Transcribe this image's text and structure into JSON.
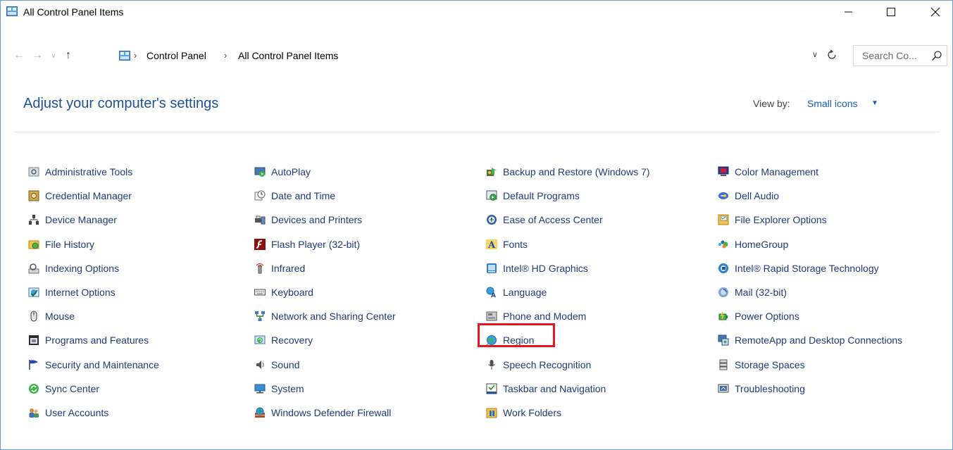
{
  "window": {
    "title": "All Control Panel Items",
    "minimize_glyph": "—",
    "maximize_glyph": "☐",
    "close_glyph": "✕"
  },
  "nav": {
    "back_glyph": "←",
    "forward_glyph": "→",
    "recent_glyph": "∨",
    "up_glyph": "↑"
  },
  "address": {
    "separator": "›",
    "crumbs": [
      "Control Panel",
      "All Control Panel Items"
    ],
    "dropdown_glyph": "∨"
  },
  "search": {
    "placeholder": "Search Co..."
  },
  "header": {
    "title": "Adjust your computer's settings",
    "view_by_label": "View by:",
    "view_by_value": "Small icons",
    "view_by_caret": "▼"
  },
  "columns": [
    {
      "items": [
        {
          "label": "Administrative Tools",
          "icon": "admin-tools-icon"
        },
        {
          "label": "Credential Manager",
          "icon": "credential-icon"
        },
        {
          "label": "Device Manager",
          "icon": "device-manager-icon"
        },
        {
          "label": "File History",
          "icon": "file-history-icon"
        },
        {
          "label": "Indexing Options",
          "icon": "indexing-icon"
        },
        {
          "label": "Internet Options",
          "icon": "internet-options-icon"
        },
        {
          "label": "Mouse",
          "icon": "mouse-icon"
        },
        {
          "label": "Programs and Features",
          "icon": "programs-icon"
        },
        {
          "label": "Security and Maintenance",
          "icon": "flag-icon"
        },
        {
          "label": "Sync Center",
          "icon": "sync-icon"
        },
        {
          "label": "User Accounts",
          "icon": "users-icon"
        }
      ]
    },
    {
      "items": [
        {
          "label": "AutoPlay",
          "icon": "autoplay-icon"
        },
        {
          "label": "Date and Time",
          "icon": "clock-icon"
        },
        {
          "label": "Devices and Printers",
          "icon": "printer-icon"
        },
        {
          "label": "Flash Player (32-bit)",
          "icon": "flash-icon"
        },
        {
          "label": "Infrared",
          "icon": "infrared-icon"
        },
        {
          "label": "Keyboard",
          "icon": "keyboard-icon"
        },
        {
          "label": "Network and Sharing Center",
          "icon": "network-icon"
        },
        {
          "label": "Recovery",
          "icon": "recovery-icon"
        },
        {
          "label": "Sound",
          "icon": "speaker-icon"
        },
        {
          "label": "System",
          "icon": "monitor-icon"
        },
        {
          "label": "Windows Defender Firewall",
          "icon": "firewall-icon"
        }
      ]
    },
    {
      "items": [
        {
          "label": "Backup and Restore (Windows 7)",
          "icon": "backup-icon"
        },
        {
          "label": "Default Programs",
          "icon": "default-programs-icon"
        },
        {
          "label": "Ease of Access Center",
          "icon": "ease-access-icon"
        },
        {
          "label": "Fonts",
          "icon": "fonts-icon"
        },
        {
          "label": "Intel® HD Graphics",
          "icon": "intel-graphics-icon"
        },
        {
          "label": "Language",
          "icon": "language-icon"
        },
        {
          "label": "Phone and Modem",
          "icon": "phone-icon"
        },
        {
          "label": "Region",
          "icon": "globe-icon"
        },
        {
          "label": "Speech Recognition",
          "icon": "microphone-icon"
        },
        {
          "label": "Taskbar and Navigation",
          "icon": "taskbar-icon"
        },
        {
          "label": "Work Folders",
          "icon": "work-folders-icon"
        }
      ]
    },
    {
      "items": [
        {
          "label": "Color Management",
          "icon": "color-monitor-icon"
        },
        {
          "label": "Dell Audio",
          "icon": "dell-audio-icon"
        },
        {
          "label": "File Explorer Options",
          "icon": "folder-options-icon"
        },
        {
          "label": "HomeGroup",
          "icon": "homegroup-icon"
        },
        {
          "label": "Intel® Rapid Storage Technology",
          "icon": "intel-storage-icon"
        },
        {
          "label": "Mail (32-bit)",
          "icon": "mail-icon"
        },
        {
          "label": "Power Options",
          "icon": "power-icon"
        },
        {
          "label": "RemoteApp and Desktop Connections",
          "icon": "remoteapp-icon"
        },
        {
          "label": "Storage Spaces",
          "icon": "storage-icon"
        },
        {
          "label": "Troubleshooting",
          "icon": "troubleshoot-icon"
        }
      ]
    }
  ],
  "colors": {
    "heading": "#1c5196",
    "link": "#213a7c",
    "highlight": "#e8141f",
    "window_border": "#6e9bcf"
  }
}
